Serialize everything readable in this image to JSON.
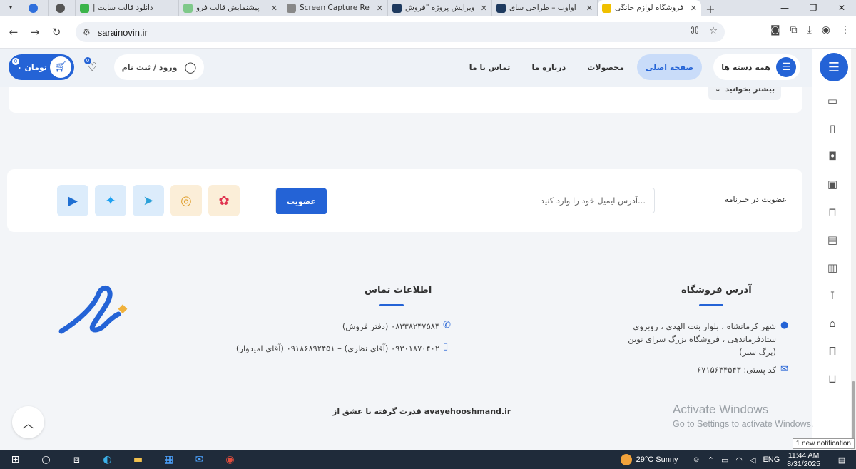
{
  "browser": {
    "tabs": [
      {
        "title": "",
        "favicon_color": "#2f6fdc",
        "active": false,
        "favicon_only": true
      },
      {
        "title": "",
        "favicon_color": "#555555",
        "active": false,
        "favicon_only": true
      },
      {
        "title": "دانلود قالب سایت |",
        "favicon_color": "#3bb44a",
        "active": false,
        "favicon_only": false
      },
      {
        "title": "پیشنمایش قالب فرو",
        "favicon_color": "#7fc98a",
        "active": false,
        "favicon_only": false
      },
      {
        "title": "Screen Capture Re",
        "favicon_color": "#888888",
        "active": false,
        "favicon_only": false
      },
      {
        "title": "ویرایش پروژه \"فروش",
        "favicon_color": "#1e3a5f",
        "active": false,
        "favicon_only": false
      },
      {
        "title": "آواوب – طراحی سای",
        "favicon_color": "#1e3a5f",
        "active": false,
        "favicon_only": false
      },
      {
        "title": "فروشگاه لوازم خانگی",
        "favicon_color": "#f0c000",
        "active": true,
        "favicon_only": false
      }
    ],
    "url": "sarainovin.ir"
  },
  "header": {
    "categories_label": "همه دسته ها",
    "nav": [
      {
        "label": "صفحه اصلی",
        "active": true
      },
      {
        "label": "محصولات",
        "active": false
      },
      {
        "label": "درباره ما",
        "active": false
      },
      {
        "label": "تماس با ما",
        "active": false
      }
    ],
    "login_label": "ورود / ثبت نام",
    "wishlist_count": "0",
    "cart_label": "۰ تومان",
    "cart_count": "0"
  },
  "content": {
    "read_more_label": "بیشتر بخوانید"
  },
  "newsletter": {
    "label": "عضویت در خبرنامه",
    "placeholder": "آدرس ایمیل خود را وارد کنید...",
    "button_label": "عضویت",
    "socials": [
      "aparat-icon",
      "instagram-icon",
      "telegram-icon",
      "twitter-icon",
      "youtube-icon"
    ]
  },
  "footer": {
    "address_title": "آدرس فروشگاه",
    "address_text": "شهر کرمانشاه ، بلوار بنت الهدی ، روبروی ستادفرماندهی ، فروشگاه بزرگ سرای نوین (برگ سبز)",
    "postal_code": "کد پستی: ۶۷۱۵۶۳۴۵۴۳",
    "contact_title": "اطلاعات تماس",
    "phone": "۰۸۳۳۸۲۴۷۵۸۴ (دفتر فروش)",
    "mobile": "۰۹۳۰۱۸۷۰۴۰۲ (آقای نظری) – ۰۹۱۸۶۸۹۲۴۵۱ (آقای امیدوار)",
    "credit": "قدرت گرفته با عشق از avayehooshmand.ir"
  },
  "windows": {
    "activate_title": "Activate Windows",
    "activate_subtitle": "Go to Settings to activate Windows.",
    "notification": "1 new notification",
    "weather": "29°C  Sunny",
    "language": "ENG",
    "time": "11:44 AM",
    "date": "8/31/2025"
  },
  "colors": {
    "accent": "#2463d6",
    "page_bg": "#f3f5f8"
  }
}
